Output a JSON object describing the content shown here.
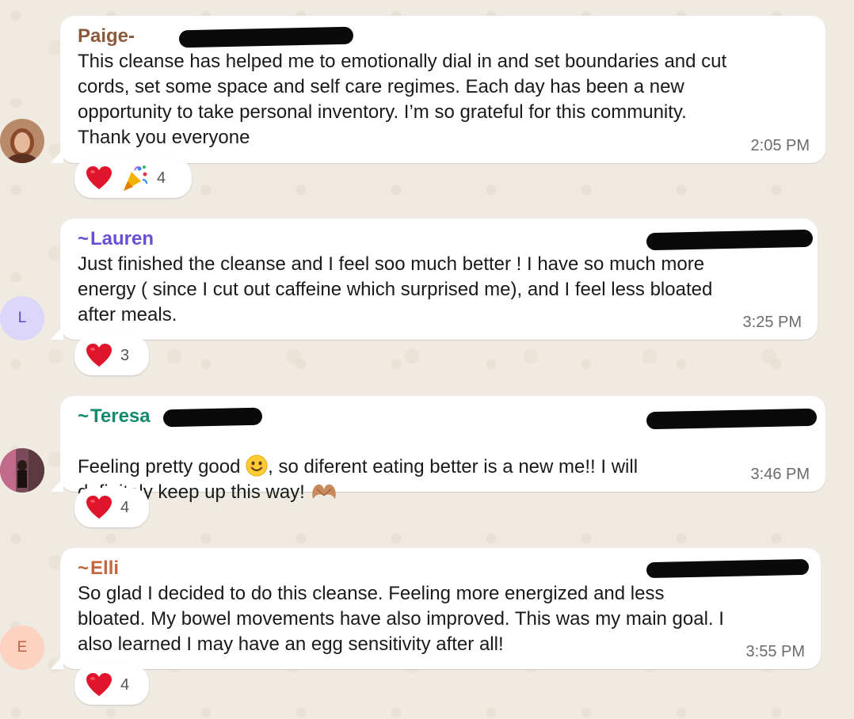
{
  "messages": [
    {
      "sender": "Paige-",
      "text": "This cleanse has helped me to emotionally dial in and set boundaries and cut\ncords, set some space and self care regimes. Each day has been a new\nopportunity to take personal inventory. I’m so grateful for this community.\nThank you everyone",
      "time": "2:05 PM",
      "reactions": [
        "heart-emoji",
        "party-popper-emoji"
      ],
      "reaction_count": "4",
      "sender_color": "#8a5a3b"
    },
    {
      "sender": "Lauren",
      "avatar_initial": "L",
      "text": "Just finished the cleanse and I feel soo much better ! I have so much more\nenergy ( since I cut out caffeine which surprised me), and I feel less bloated\nafter meals.",
      "time": "3:25 PM",
      "reactions": [
        "heart-emoji"
      ],
      "reaction_count": "3",
      "sender_color": "#6a4fd6"
    },
    {
      "sender": "Teresa",
      "text_part1": "Feeling pretty good ",
      "text_part2": ", so diferent eating better is a new me!! I will",
      "text_line2": "definitely keep up this way! ",
      "time": "3:46 PM",
      "reactions": [
        "heart-emoji"
      ],
      "reaction_count": "4",
      "sender_color": "#128a6e"
    },
    {
      "sender": "Elli",
      "avatar_initial": "E",
      "text": "So glad I decided to do this cleanse. Feeling more energized and less\nbloated. My bowel movements have also improved. This was my main goal. I\nalso learned I may have an egg sensitivity after all!",
      "time": "3:55 PM",
      "reactions": [
        "heart-emoji"
      ],
      "reaction_count": "4",
      "sender_color": "#c8643c"
    }
  ],
  "sender_prefix": "~"
}
